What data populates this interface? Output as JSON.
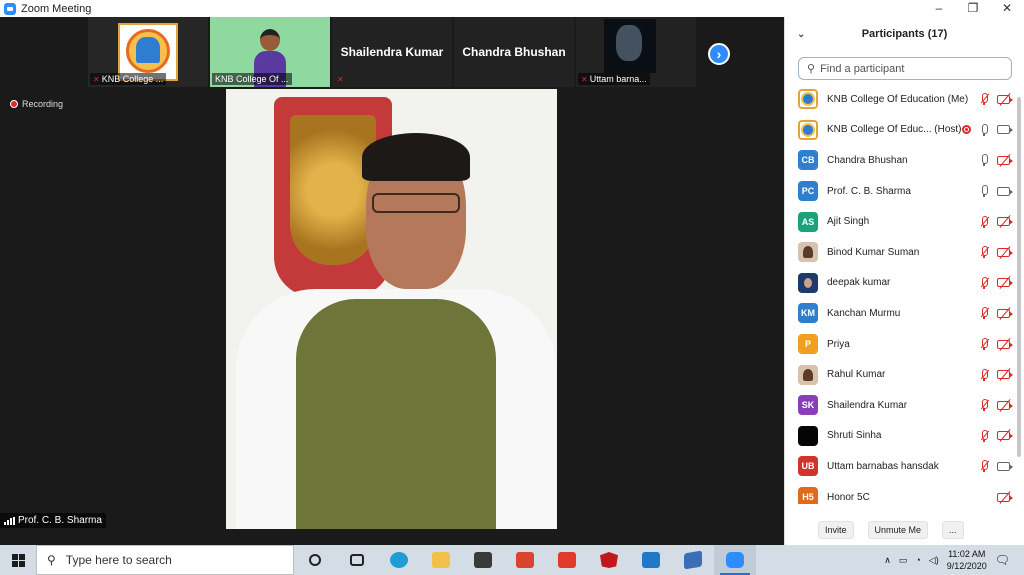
{
  "window": {
    "title": "Zoom Meeting",
    "controls": [
      "–",
      "❐",
      "✕"
    ]
  },
  "thumbnails": [
    {
      "name": "KNB College ...",
      "type": "logo",
      "muted": true
    },
    {
      "name": "KNB College Of ...",
      "type": "person",
      "muted": true
    },
    {
      "name": "Shailendra Kumar",
      "type": "text",
      "muted": true
    },
    {
      "name": "Chandra Bhushan",
      "type": "text",
      "muted": false
    },
    {
      "name": "Uttam barna...",
      "type": "photo",
      "muted": true
    }
  ],
  "recording_label": "Recording",
  "active_speaker": "Prof. C. B. Sharma",
  "participants_panel": {
    "title": "Participants (17)",
    "search_placeholder": "Find a participant",
    "participants": [
      {
        "name": "KNB College Of Education (Me)",
        "avatar": "logo",
        "initials": "",
        "color": "",
        "mic": "muted",
        "cam": "off",
        "rec": false
      },
      {
        "name": "KNB College Of Educ... (Host)",
        "avatar": "logo",
        "initials": "",
        "color": "",
        "mic": "on",
        "cam": "on",
        "rec": true
      },
      {
        "name": "Chandra Bhushan",
        "avatar": "initials",
        "initials": "CB",
        "color": "#2f7fcf",
        "mic": "on",
        "cam": "off",
        "rec": false
      },
      {
        "name": "Prof. C. B. Sharma",
        "avatar": "initials",
        "initials": "PC",
        "color": "#2f7fcf",
        "mic": "on",
        "cam": "on",
        "rec": false
      },
      {
        "name": "Ajit Singh",
        "avatar": "initials",
        "initials": "AS",
        "color": "#1aa37a",
        "mic": "muted",
        "cam": "off",
        "rec": false
      },
      {
        "name": "Binod Kumar Suman",
        "avatar": "person",
        "initials": "",
        "color": "",
        "mic": "muted",
        "cam": "off",
        "rec": false
      },
      {
        "name": "deepak kumar",
        "avatar": "blue",
        "initials": "",
        "color": "",
        "mic": "muted",
        "cam": "off",
        "rec": false
      },
      {
        "name": "Kanchan Murmu",
        "avatar": "initials",
        "initials": "KM",
        "color": "#2f7fcf",
        "mic": "muted",
        "cam": "off",
        "rec": false
      },
      {
        "name": "Priya",
        "avatar": "initials",
        "initials": "P",
        "color": "#f0a020",
        "mic": "muted",
        "cam": "off",
        "rec": false
      },
      {
        "name": "Rahul Kumar",
        "avatar": "person",
        "initials": "",
        "color": "",
        "mic": "muted",
        "cam": "off",
        "rec": false
      },
      {
        "name": "Shailendra Kumar",
        "avatar": "initials",
        "initials": "SK",
        "color": "#8a3fb8",
        "mic": "muted",
        "cam": "off",
        "rec": false
      },
      {
        "name": "Shruti Sinha",
        "avatar": "black",
        "initials": "",
        "color": "",
        "mic": "muted",
        "cam": "off",
        "rec": false
      },
      {
        "name": "Uttam barnabas hansdak",
        "avatar": "initials",
        "initials": "UB",
        "color": "#d0342c",
        "mic": "muted",
        "cam": "on",
        "rec": false
      },
      {
        "name": "Honor 5C",
        "avatar": "initials",
        "initials": "H5",
        "color": "#e06a1a",
        "mic": "none",
        "cam": "off",
        "rec": false
      }
    ],
    "footer": {
      "invite": "Invite",
      "unmute_me": "Unmute Me",
      "more": "..."
    }
  },
  "taskbar": {
    "search_placeholder": "Type here to search",
    "time": "11:02 AM",
    "date": "9/12/2020",
    "apps": [
      "task-view",
      "edge",
      "file-explorer",
      "store",
      "office",
      "acrobat",
      "mcafee",
      "mail",
      "app",
      "zoom"
    ]
  },
  "colors": {
    "zoom_blue": "#2d8cff",
    "muted_red": "#e02828"
  }
}
